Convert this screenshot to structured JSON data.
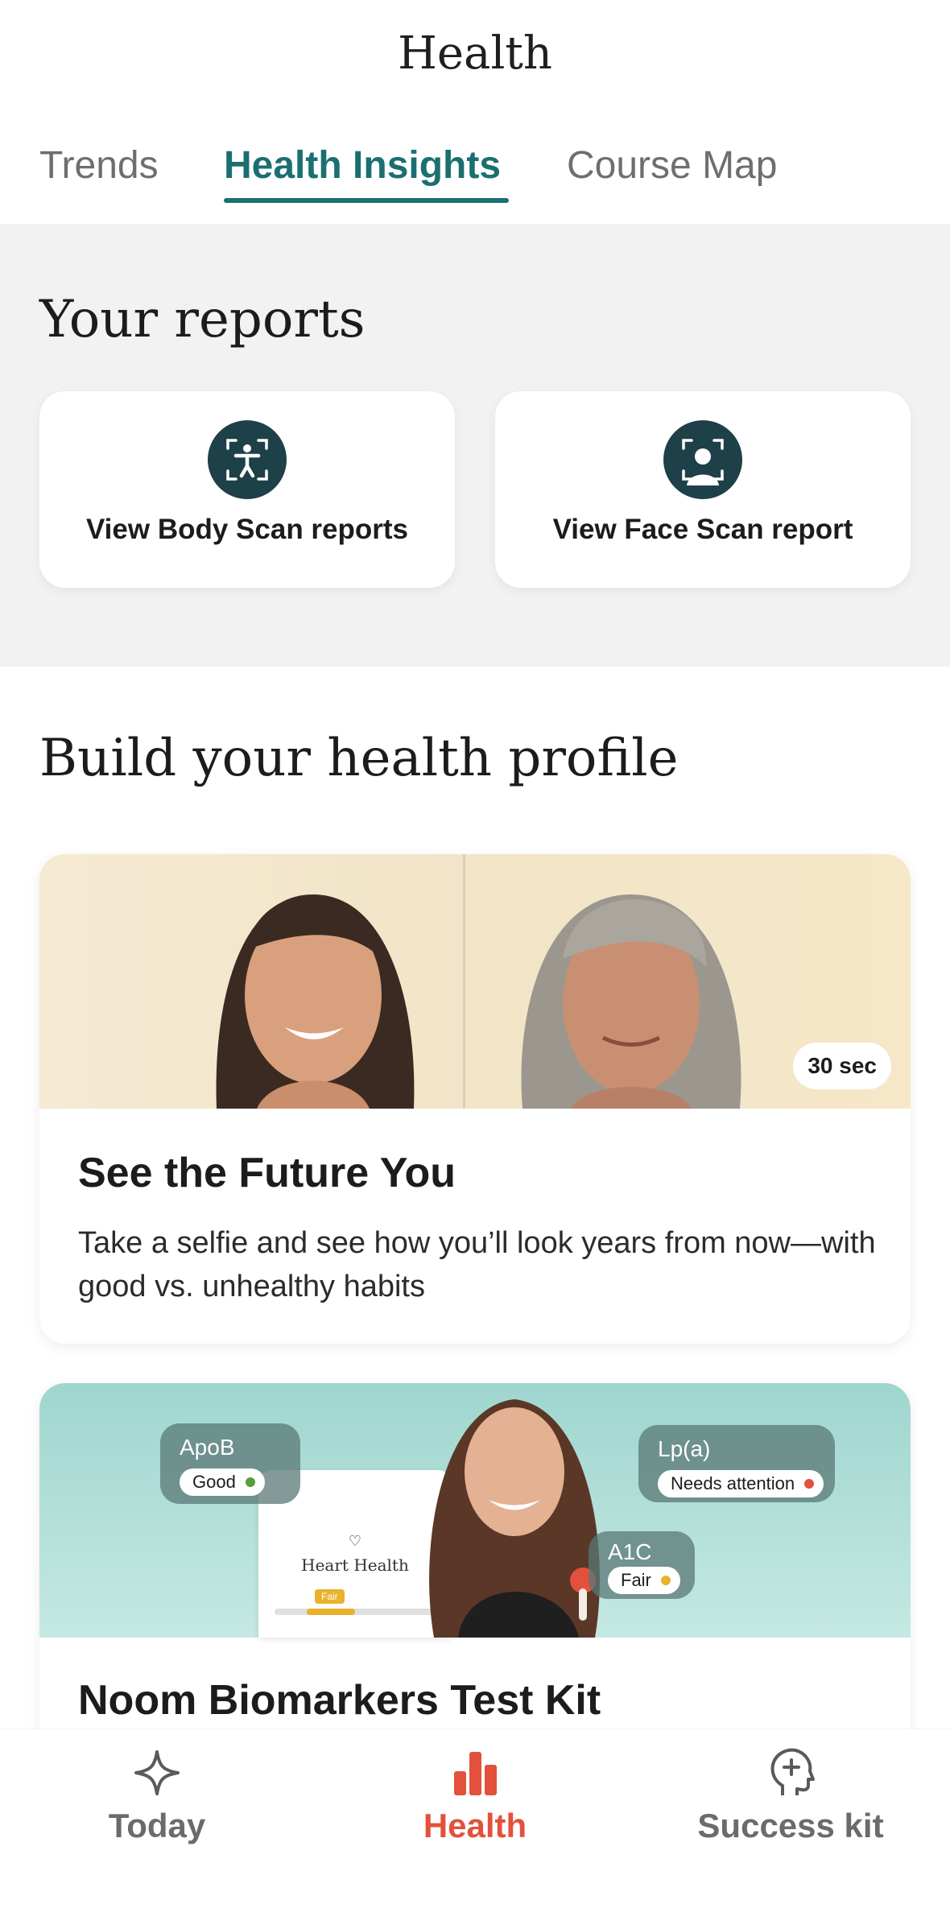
{
  "header": {
    "title": "Health"
  },
  "tabs": [
    {
      "label": "Trends",
      "active": false
    },
    {
      "label": "Health Insights",
      "active": true
    },
    {
      "label": "Course Map",
      "active": false
    }
  ],
  "reports": {
    "title": "Your reports",
    "cards": [
      {
        "label": "View Body Scan reports",
        "icon": "body-scan-icon"
      },
      {
        "label": "View Face Scan report",
        "icon": "face-scan-icon"
      }
    ]
  },
  "health_profile": {
    "title": "Build your health profile",
    "cards": [
      {
        "title": "See the Future You",
        "description": "Take a selfie and see how you’ll look years from now—with good vs. unhealthy habits",
        "badge": "30 sec"
      },
      {
        "title": "Noom Biomarkers Test Kit",
        "biomarkers": [
          {
            "name": "ApoB",
            "status": "Good",
            "color": "#5a9e3a"
          },
          {
            "name": "Lp(a)",
            "status": "Needs attention",
            "color": "#e3513d"
          },
          {
            "name": "A1C",
            "status": "Fair",
            "color": "#e8b22c"
          }
        ],
        "phone_screen": {
          "title": "Heart Health",
          "level": "Fair"
        }
      }
    ]
  },
  "bottom_nav": [
    {
      "label": "Today",
      "icon": "sparkle-icon",
      "active": false
    },
    {
      "label": "Health",
      "icon": "bar-chart-icon",
      "active": true
    },
    {
      "label": "Success kit",
      "icon": "head-plus-icon",
      "active": false
    }
  ],
  "colors": {
    "accent": "#1b6f70",
    "active_nav": "#e3513d",
    "icon_bg": "#1e4048"
  }
}
